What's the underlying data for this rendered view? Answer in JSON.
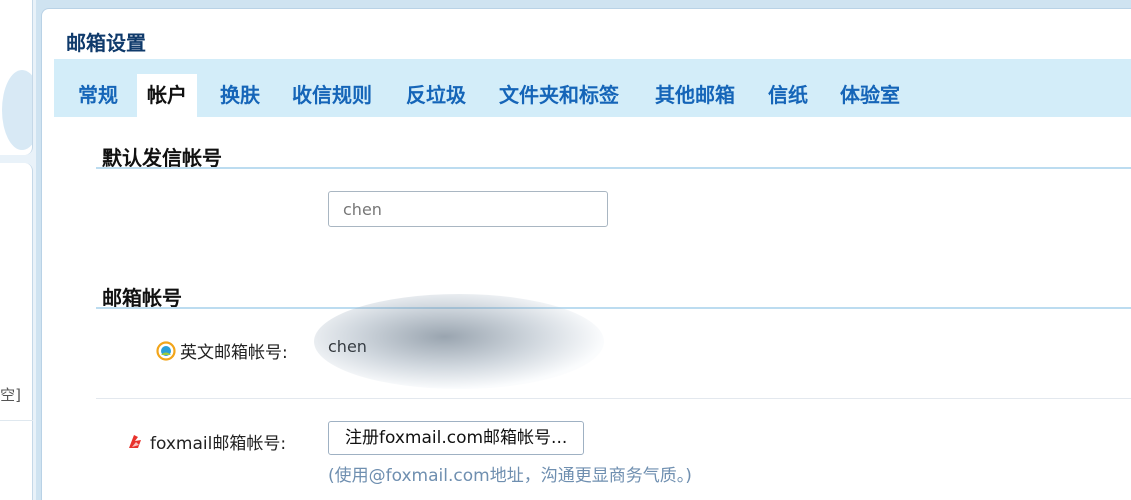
{
  "sidebar": {
    "empty_label": "空]"
  },
  "page": {
    "title": "邮箱设置"
  },
  "tabs": [
    {
      "label": "常规",
      "active": false
    },
    {
      "label": "帐户",
      "active": true
    },
    {
      "label": "换肤",
      "active": false
    },
    {
      "label": "收信规则",
      "active": false
    },
    {
      "label": "反垃圾",
      "active": false
    },
    {
      "label": "文件夹和标签",
      "active": false
    },
    {
      "label": "其他邮箱",
      "active": false
    },
    {
      "label": "信纸",
      "active": false
    },
    {
      "label": "体验室",
      "active": false
    }
  ],
  "default_sender": {
    "section_title": "默认发信帐号",
    "value": "chen"
  },
  "mailbox_account": {
    "section_title": "邮箱帐号",
    "english_label": "英文邮箱帐号:",
    "english_value": "chen",
    "foxmail_label": "foxmail邮箱帐号:",
    "register_button": "注册foxmail.com邮箱帐号...",
    "hint": "(使用@foxmail.com地址，沟通更显商务气质。)"
  },
  "colors": {
    "tab_bar_bg": "#d3edf9",
    "tab_text": "#1565b8",
    "title_text": "#0f3a6b",
    "hint_text": "#6f8fb0",
    "foxmail_icon": "#e8322c"
  }
}
